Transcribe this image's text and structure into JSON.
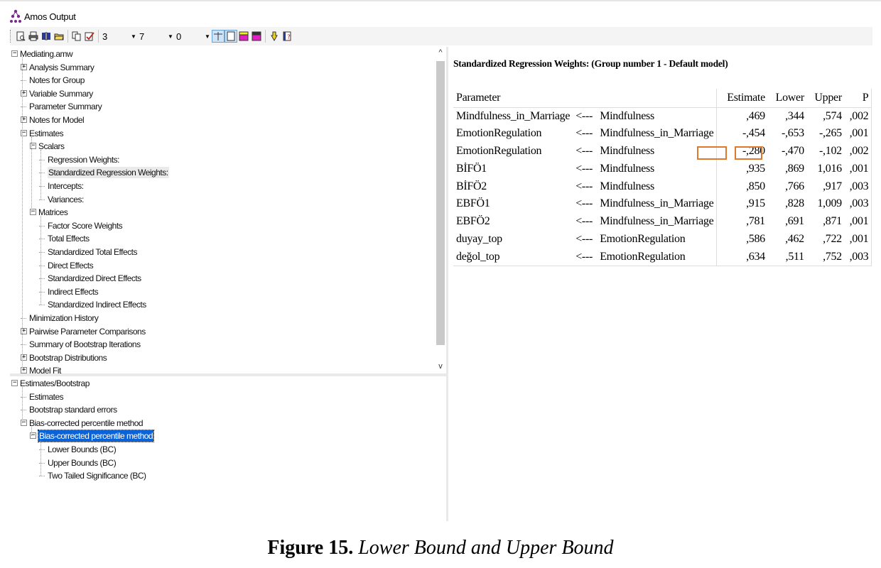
{
  "window": {
    "title": "Amos Output"
  },
  "toolbar": {
    "combos": [
      {
        "value": "3"
      },
      {
        "value": "7"
      },
      {
        "value": "0"
      }
    ]
  },
  "tree_top": [
    {
      "label": "Mediating.amw",
      "level": 0,
      "expander": "minus"
    },
    {
      "label": "Analysis Summary",
      "level": 1,
      "expander": "plus"
    },
    {
      "label": "Notes for Group",
      "level": 1,
      "expander": "none"
    },
    {
      "label": "Variable Summary",
      "level": 1,
      "expander": "plus"
    },
    {
      "label": "Parameter Summary",
      "level": 1,
      "expander": "none"
    },
    {
      "label": "Notes for Model",
      "level": 1,
      "expander": "plus"
    },
    {
      "label": "Estimates",
      "level": 1,
      "expander": "minus"
    },
    {
      "label": "Scalars",
      "level": 2,
      "expander": "minus"
    },
    {
      "label": "Regression Weights:",
      "level": 3,
      "expander": "none"
    },
    {
      "label": "Standardized Regression Weights:",
      "level": 3,
      "expander": "none",
      "selected": "grey"
    },
    {
      "label": "Intercepts:",
      "level": 3,
      "expander": "none"
    },
    {
      "label": "Variances:",
      "level": 3,
      "expander": "none"
    },
    {
      "label": "Matrices",
      "level": 2,
      "expander": "minus"
    },
    {
      "label": "Factor Score Weights",
      "level": 3,
      "expander": "none"
    },
    {
      "label": "Total Effects",
      "level": 3,
      "expander": "none"
    },
    {
      "label": "Standardized Total Effects",
      "level": 3,
      "expander": "none"
    },
    {
      "label": "Direct Effects",
      "level": 3,
      "expander": "none"
    },
    {
      "label": "Standardized Direct Effects",
      "level": 3,
      "expander": "none"
    },
    {
      "label": "Indirect Effects",
      "level": 3,
      "expander": "none"
    },
    {
      "label": "Standardized Indirect Effects",
      "level": 3,
      "expander": "none"
    },
    {
      "label": "Minimization History",
      "level": 1,
      "expander": "none"
    },
    {
      "label": "Pairwise Parameter Comparisons",
      "level": 1,
      "expander": "plus"
    },
    {
      "label": "Summary of Bootstrap Iterations",
      "level": 1,
      "expander": "none"
    },
    {
      "label": "Bootstrap Distributions",
      "level": 1,
      "expander": "plus"
    },
    {
      "label": "Model Fit",
      "level": 1,
      "expander": "plus"
    }
  ],
  "tree_bottom": [
    {
      "label": "Estimates/Bootstrap",
      "level": 0,
      "expander": "minus"
    },
    {
      "label": "Estimates",
      "level": 1,
      "expander": "none"
    },
    {
      "label": "Bootstrap standard errors",
      "level": 1,
      "expander": "none"
    },
    {
      "label": "Bias-corrected percentile method",
      "level": 1,
      "expander": "minus"
    },
    {
      "label": "Bias-corrected percentile method",
      "level": 2,
      "expander": "minus",
      "selected": "blue"
    },
    {
      "label": "Lower Bounds (BC)",
      "level": 3,
      "expander": "none"
    },
    {
      "label": "Upper Bounds (BC)",
      "level": 3,
      "expander": "none"
    },
    {
      "label": "Two Tailed Significance (BC)",
      "level": 3,
      "expander": "none"
    }
  ],
  "content": {
    "title": "Standardized Regression Weights: (Group number 1 - Default model)",
    "headers": {
      "parameter": "Parameter",
      "estimate": "Estimate",
      "lower": "Lower",
      "upper": "Upper",
      "p": "P"
    },
    "rows": [
      {
        "dep": "Mindfulness_in_Marriage",
        "arrow": "<---",
        "ind": "Mindfulness",
        "estimate": ",469",
        "lower": ",344",
        "upper": ",574",
        "p": ",002"
      },
      {
        "dep": "EmotionRegulation",
        "arrow": "<---",
        "ind": "Mindfulness_in_Marriage",
        "estimate": "-,454",
        "lower": "-,653",
        "upper": "-,265",
        "p": ",001"
      },
      {
        "dep": "EmotionRegulation",
        "arrow": "<---",
        "ind": "Mindfulness",
        "estimate": "-,280",
        "lower": "-,470",
        "upper": "-,102",
        "p": ",002"
      },
      {
        "dep": "BİFÖ1",
        "arrow": "<---",
        "ind": "Mindfulness",
        "estimate": ",935",
        "lower": ",869",
        "upper": "1,016",
        "p": ",001"
      },
      {
        "dep": "BİFÖ2",
        "arrow": "<---",
        "ind": "Mindfulness",
        "estimate": ",850",
        "lower": ",766",
        "upper": ",917",
        "p": ",003"
      },
      {
        "dep": "EBFÖ1",
        "arrow": "<---",
        "ind": "Mindfulness_in_Marriage",
        "estimate": ",915",
        "lower": ",828",
        "upper": "1,009",
        "p": ",003"
      },
      {
        "dep": "EBFÖ2",
        "arrow": "<---",
        "ind": "Mindfulness_in_Marriage",
        "estimate": ",781",
        "lower": ",691",
        "upper": ",871",
        "p": ",001"
      },
      {
        "dep": "duyay_top",
        "arrow": "<---",
        "ind": "EmotionRegulation",
        "estimate": ",586",
        "lower": ",462",
        "upper": ",722",
        "p": ",001"
      },
      {
        "dep": "değol_top",
        "arrow": "<---",
        "ind": "EmotionRegulation",
        "estimate": ",634",
        "lower": ",511",
        "upper": ",752",
        "p": ",003"
      }
    ]
  },
  "caption": {
    "label": "Figure 15.",
    "text": "Lower Bound and Upper Bound"
  },
  "colors": {
    "highlight": "#e07a2a",
    "selection": "#0a64d8"
  }
}
